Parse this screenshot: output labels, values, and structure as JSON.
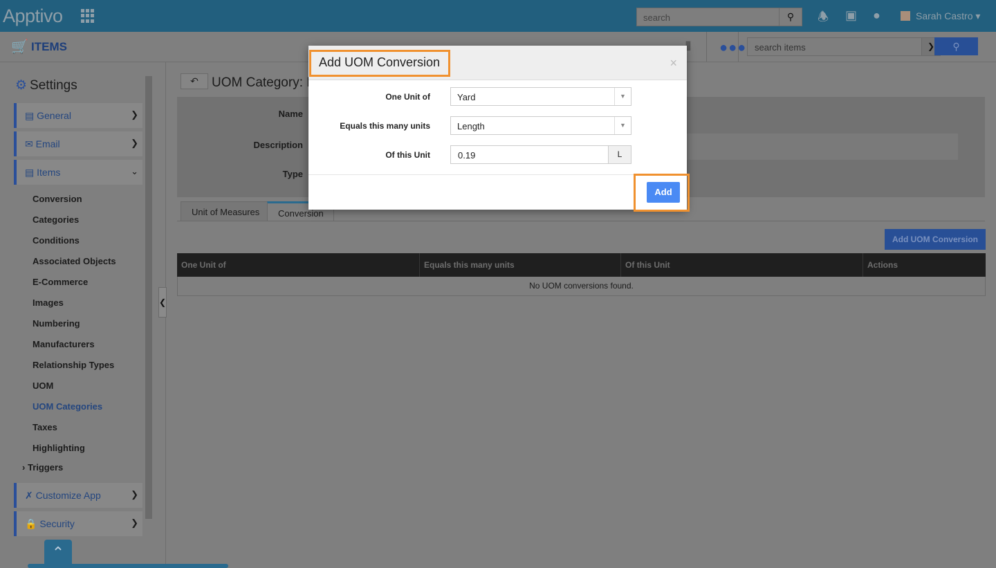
{
  "header": {
    "logo": "Apptivo",
    "search_placeholder": "search",
    "user": "Sarah Castro"
  },
  "subheader": {
    "app": "ITEMS",
    "search_placeholder": "search items"
  },
  "sidebar": {
    "title": "Settings",
    "sections": [
      {
        "label": "General"
      },
      {
        "label": "Email"
      },
      {
        "label": "Items"
      }
    ],
    "items": [
      "Conversion",
      "Categories",
      "Conditions",
      "Associated Objects",
      "E-Commerce",
      "Images",
      "Numbering",
      "Manufacturers",
      "Relationship Types",
      "UOM",
      "UOM Categories",
      "Taxes",
      "Highlighting"
    ],
    "active_item": "UOM Categories",
    "triggers": "Triggers",
    "bottom_sections": [
      {
        "label": "Customize App"
      },
      {
        "label": "Security"
      }
    ]
  },
  "main": {
    "title": "UOM Category: M",
    "fields": {
      "name": "Name",
      "description": "Description",
      "type": "Type"
    },
    "tabs": [
      "Unit of Measures",
      "Conversion"
    ],
    "active_tab": "Conversion",
    "add_button": "Add UOM Conversion",
    "table": {
      "columns": [
        "One Unit of",
        "Equals this many units",
        "Of this Unit",
        "Actions"
      ],
      "empty": "No UOM conversions found."
    }
  },
  "modal": {
    "title": "Add UOM Conversion",
    "close": "×",
    "fields": {
      "one_unit_label": "One Unit of",
      "one_unit_value": "Yard",
      "equals_label": "Equals this many units",
      "equals_value": "Length",
      "of_unit_label": "Of this Unit",
      "of_unit_value": "0.19",
      "of_unit_suffix": "L"
    },
    "add": "Add"
  },
  "colors": {
    "highlight": "#f0912f",
    "primary": "#4a8af4"
  }
}
